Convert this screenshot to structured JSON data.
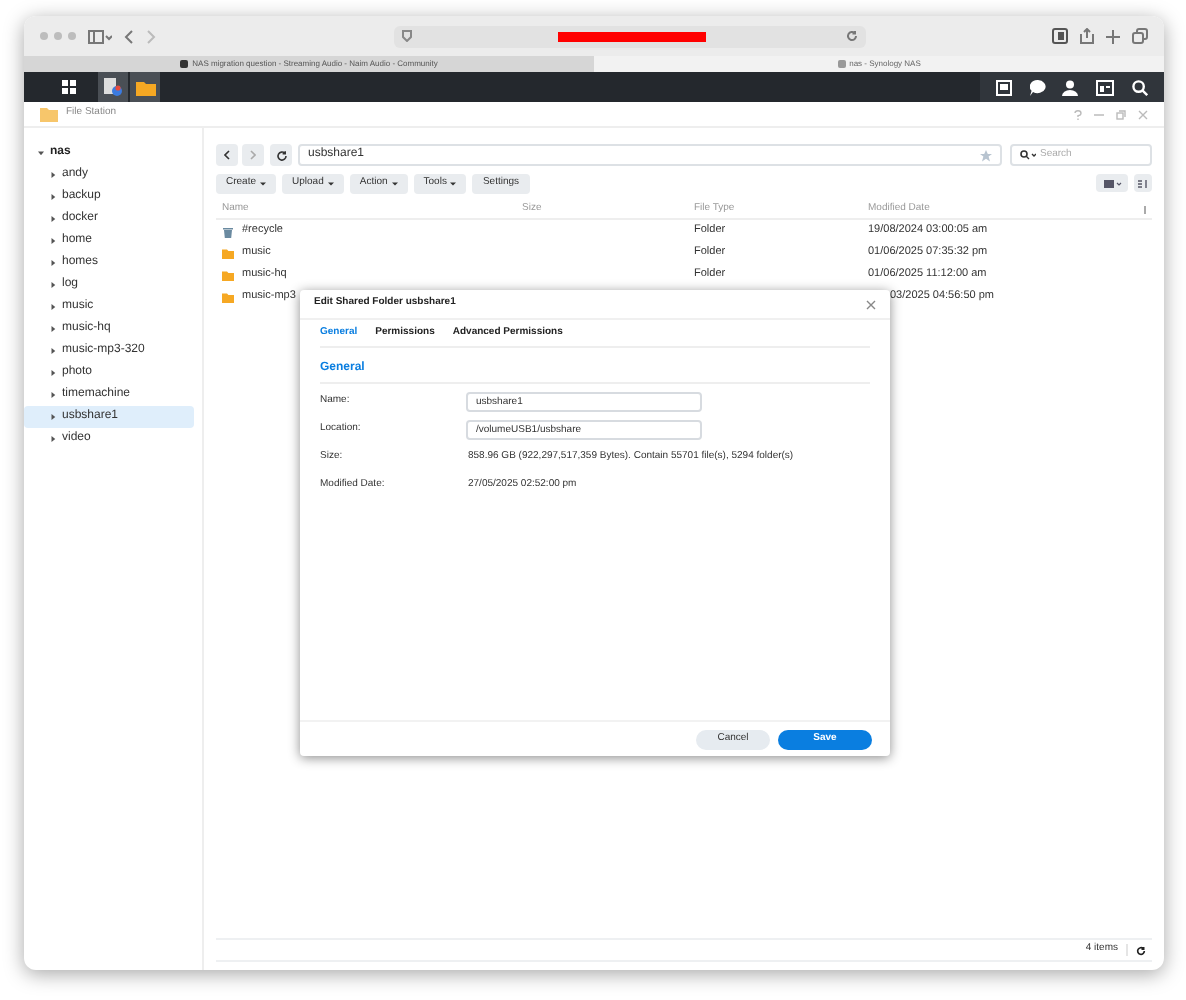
{
  "browser": {
    "tabs": [
      {
        "title": "NAS migration question - Streaming Audio - Naim Audio - Community",
        "selected": false
      },
      {
        "title": "nas - Synology NAS",
        "selected": true
      }
    ]
  },
  "file_station": {
    "title": "File Station",
    "tree": {
      "label": "nas",
      "expanded": true,
      "children": [
        {
          "label": "andy",
          "selected": false
        },
        {
          "label": "backup",
          "selected": false
        },
        {
          "label": "docker",
          "selected": false
        },
        {
          "label": "home",
          "selected": false
        },
        {
          "label": "homes",
          "selected": false
        },
        {
          "label": "log",
          "selected": false
        },
        {
          "label": "music",
          "selected": false
        },
        {
          "label": "music-hq",
          "selected": false
        },
        {
          "label": "music-mp3-320",
          "selected": false
        },
        {
          "label": "photo",
          "selected": false
        },
        {
          "label": "timemachine",
          "selected": false
        },
        {
          "label": "usbshare1",
          "selected": true
        },
        {
          "label": "video",
          "selected": false
        }
      ]
    },
    "path": "usbshare1",
    "search": {
      "placeholder": "Search"
    },
    "toolbar": [
      {
        "label": "Create",
        "dropdown": true
      },
      {
        "label": "Upload",
        "dropdown": true
      },
      {
        "label": "Action",
        "dropdown": true
      },
      {
        "label": "Tools",
        "dropdown": true
      },
      {
        "label": "Settings",
        "dropdown": false
      }
    ],
    "columns": [
      "Name",
      "Size",
      "File Type",
      "Modified Date"
    ],
    "rows": [
      {
        "kind": "recycle",
        "name": "#recycle",
        "type": "Folder",
        "modified": "19/08/2024 03:00:05 am"
      },
      {
        "kind": "folder",
        "name": "music",
        "type": "Folder",
        "modified": "01/06/2025 07:35:32 pm"
      },
      {
        "kind": "folder",
        "name": "music-hq",
        "type": "Folder",
        "modified": "01/06/2025 11:12:00 am"
      },
      {
        "kind": "folder",
        "name": "music-mp3",
        "modified": "03/2025 04:56:50 pm"
      }
    ],
    "status": "4 items"
  },
  "dialog": {
    "title": "Edit Shared Folder usbshare1",
    "tabs": [
      {
        "label": "General",
        "selected": true
      },
      {
        "label": "Permissions",
        "selected": false
      },
      {
        "label": "Advanced Permissions",
        "selected": false
      }
    ],
    "section": "General",
    "fields": [
      {
        "kind": "input",
        "label": "Name:",
        "value": "usbshare1"
      },
      {
        "kind": "input",
        "label": "Location:",
        "value": "/volumeUSB1/usbshare"
      },
      {
        "kind": "text",
        "label": "Size:",
        "value": "858.96 GB (922,297,517,359 Bytes). Contain 55701 file(s), 5294 folder(s)"
      },
      {
        "kind": "text",
        "label": "Modified Date:",
        "value": "27/05/2025 02:52:00 pm"
      }
    ],
    "buttons": [
      {
        "label": "Cancel",
        "kind": "secondary"
      },
      {
        "label": "Save",
        "kind": "primary"
      }
    ]
  }
}
